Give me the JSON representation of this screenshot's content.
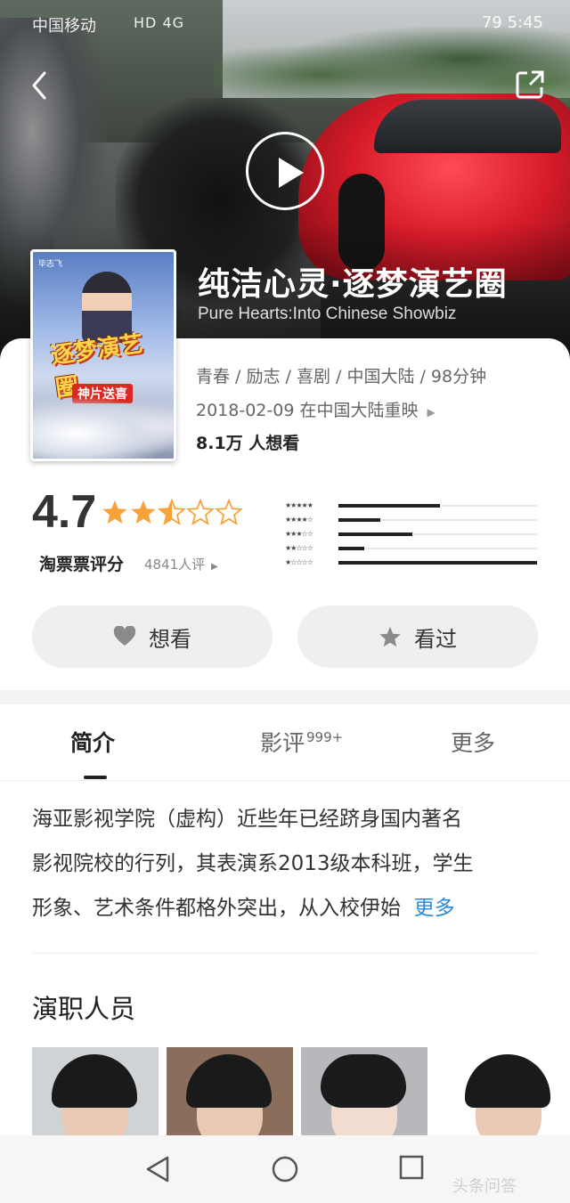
{
  "status_bar": {
    "carrier": "中国移动",
    "signal": "HD 4G",
    "right": "79 5:45"
  },
  "hero": {
    "back_icon": "chevron-left-icon",
    "share_icon": "share-icon",
    "play_icon": "play-icon"
  },
  "movie": {
    "title": "纯洁心灵·逐梦演艺圈",
    "subtitle": "Pure Hearts:Into Chinese Showbiz",
    "meta_genres": "青春 / 励志 / 喜剧 / 中国大陆 / 98分钟",
    "meta_release": "2018-02-09 在中国大陆重映",
    "want_count": "8.1万 人想看",
    "poster": {
      "title": "逐梦演艺圈",
      "badge": "神片送喜",
      "top": "毕志飞"
    }
  },
  "rating": {
    "score": "4.7",
    "stars_out_of_5": 2.5,
    "label": "淘票票评分",
    "count": "4841人评",
    "distribution": [
      {
        "stars": 5,
        "fraction": 0.51
      },
      {
        "stars": 4,
        "fraction": 0.21
      },
      {
        "stars": 3,
        "fraction": 0.37
      },
      {
        "stars": 2,
        "fraction": 0.13
      },
      {
        "stars": 1,
        "fraction": 1.0
      }
    ]
  },
  "actions": {
    "want_label": "想看",
    "seen_label": "看过"
  },
  "tabs": {
    "intro": "简介",
    "review": "影评",
    "review_badge": "999+",
    "more": "更多"
  },
  "intro": {
    "line1": "海亚影视学院（虚构）近些年已经跻身国内著名",
    "line2": "影视院校的行列，其表演系2013级本科班，学生",
    "line3": "形象、艺术条件都格外突出，从入校伊始",
    "more": "更多"
  },
  "cast": {
    "title": "演职人员"
  },
  "watermark": "头条问答",
  "colors": {
    "star": "#f7a23b",
    "link": "#2a8ad8"
  }
}
